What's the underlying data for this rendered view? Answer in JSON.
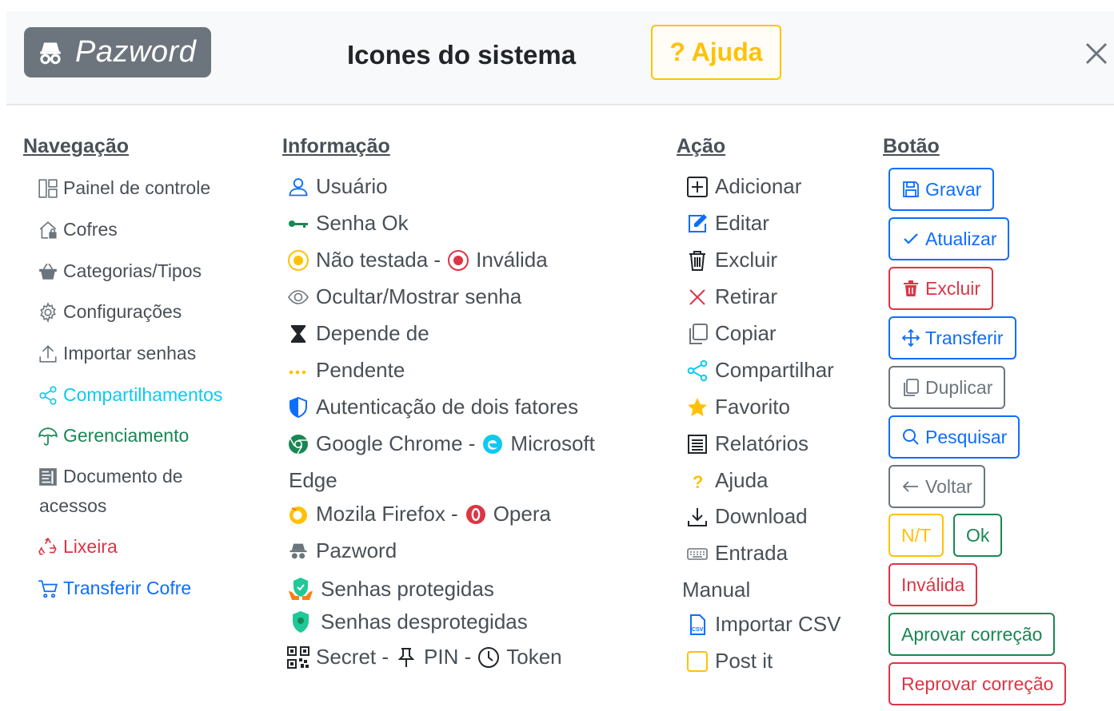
{
  "header": {
    "brand": "Pazword",
    "title": "Icones do sistema",
    "help_label": "? Ajuda"
  },
  "columns": {
    "navegacao": "Navegação",
    "informacao": "Informação",
    "acao": "Ação",
    "botao": "Botão"
  },
  "nav": {
    "painel": "Painel de controle",
    "cofres": "Cofres",
    "categorias": "Categorias/Tipos",
    "configuracoes": "Configurações",
    "importar": "Importar senhas",
    "compartilhamentos": "Compartilhamentos",
    "gerenciamento": "Gerenciamento",
    "documento_line1": "Documento de",
    "documento_line2": "acessos",
    "lixeira": "Lixeira",
    "transferir_cofre": "Transferir Cofre"
  },
  "info": {
    "usuario": "Usuário",
    "senha_ok": "Senha Ok",
    "nao_testada": "Não testada -",
    "invalida": "Inválida",
    "ocultar": "Ocultar/Mostrar senha",
    "depende": "Depende de",
    "pendente": "Pendente",
    "autenticacao": "Autenticação de dois fatores",
    "chrome": "Google Chrome -",
    "microsoft": "Microsoft",
    "edge": "Edge",
    "firefox": "Mozila Firefox -",
    "opera": "Opera",
    "pazword": "Pazword",
    "protegidas": "Senhas protegidas",
    "desprotegidas": "Senhas desprotegidas",
    "secret": "Secret -",
    "pin": "PIN -",
    "token": "Token"
  },
  "acao": {
    "adicionar": "Adicionar",
    "editar": "Editar",
    "excluir": "Excluir",
    "retirar": "Retirar",
    "copiar": "Copiar",
    "compartilhar": "Compartilhar",
    "favorito": "Favorito",
    "relatorios": "Relatórios",
    "ajuda": "Ajuda",
    "download": "Download",
    "entrada": "Entrada",
    "manual": "Manual",
    "importar_csv": "Importar CSV",
    "post_it": "Post it"
  },
  "botoes": {
    "gravar": "Gravar",
    "atualizar": "Atualizar",
    "excluir": "Excluir",
    "transferir": "Transferir",
    "duplicar": "Duplicar",
    "pesquisar": "Pesquisar",
    "voltar": "Voltar",
    "nt": "N/T",
    "ok": "Ok",
    "invalida": "Inválida",
    "aprovar": "Aprovar correção",
    "reprovar": "Reprovar correção"
  },
  "colors": {
    "primary": "#0d6efd",
    "danger": "#dc3545",
    "success": "#198754",
    "warning": "#ffc107",
    "secondary": "#6c757d",
    "info": "#0dcaf0"
  }
}
